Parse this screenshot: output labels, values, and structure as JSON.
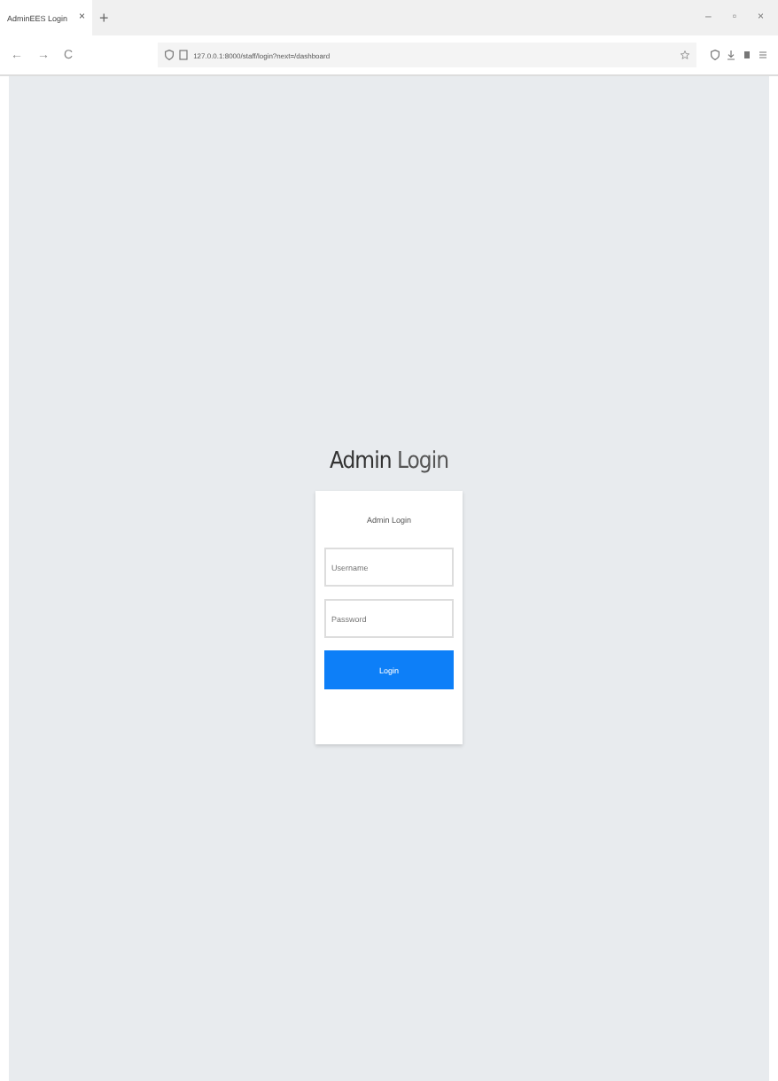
{
  "browser": {
    "tab": {
      "title": "AdminEES Login",
      "close": "×"
    },
    "new_tab": "+",
    "window_controls": [
      "–",
      "▫",
      "×"
    ],
    "nav": [
      "←",
      "→",
      "C"
    ],
    "url": "127.0.0.1:8000/staff/login?next=/dashboard"
  },
  "page": {
    "heading": "**Admin** Login",
    "card_title": "Admin Login",
    "fields": [
      {
        "placeholder": "Username"
      },
      {
        "placeholder": "Password"
      }
    ],
    "submit": "Login"
  }
}
